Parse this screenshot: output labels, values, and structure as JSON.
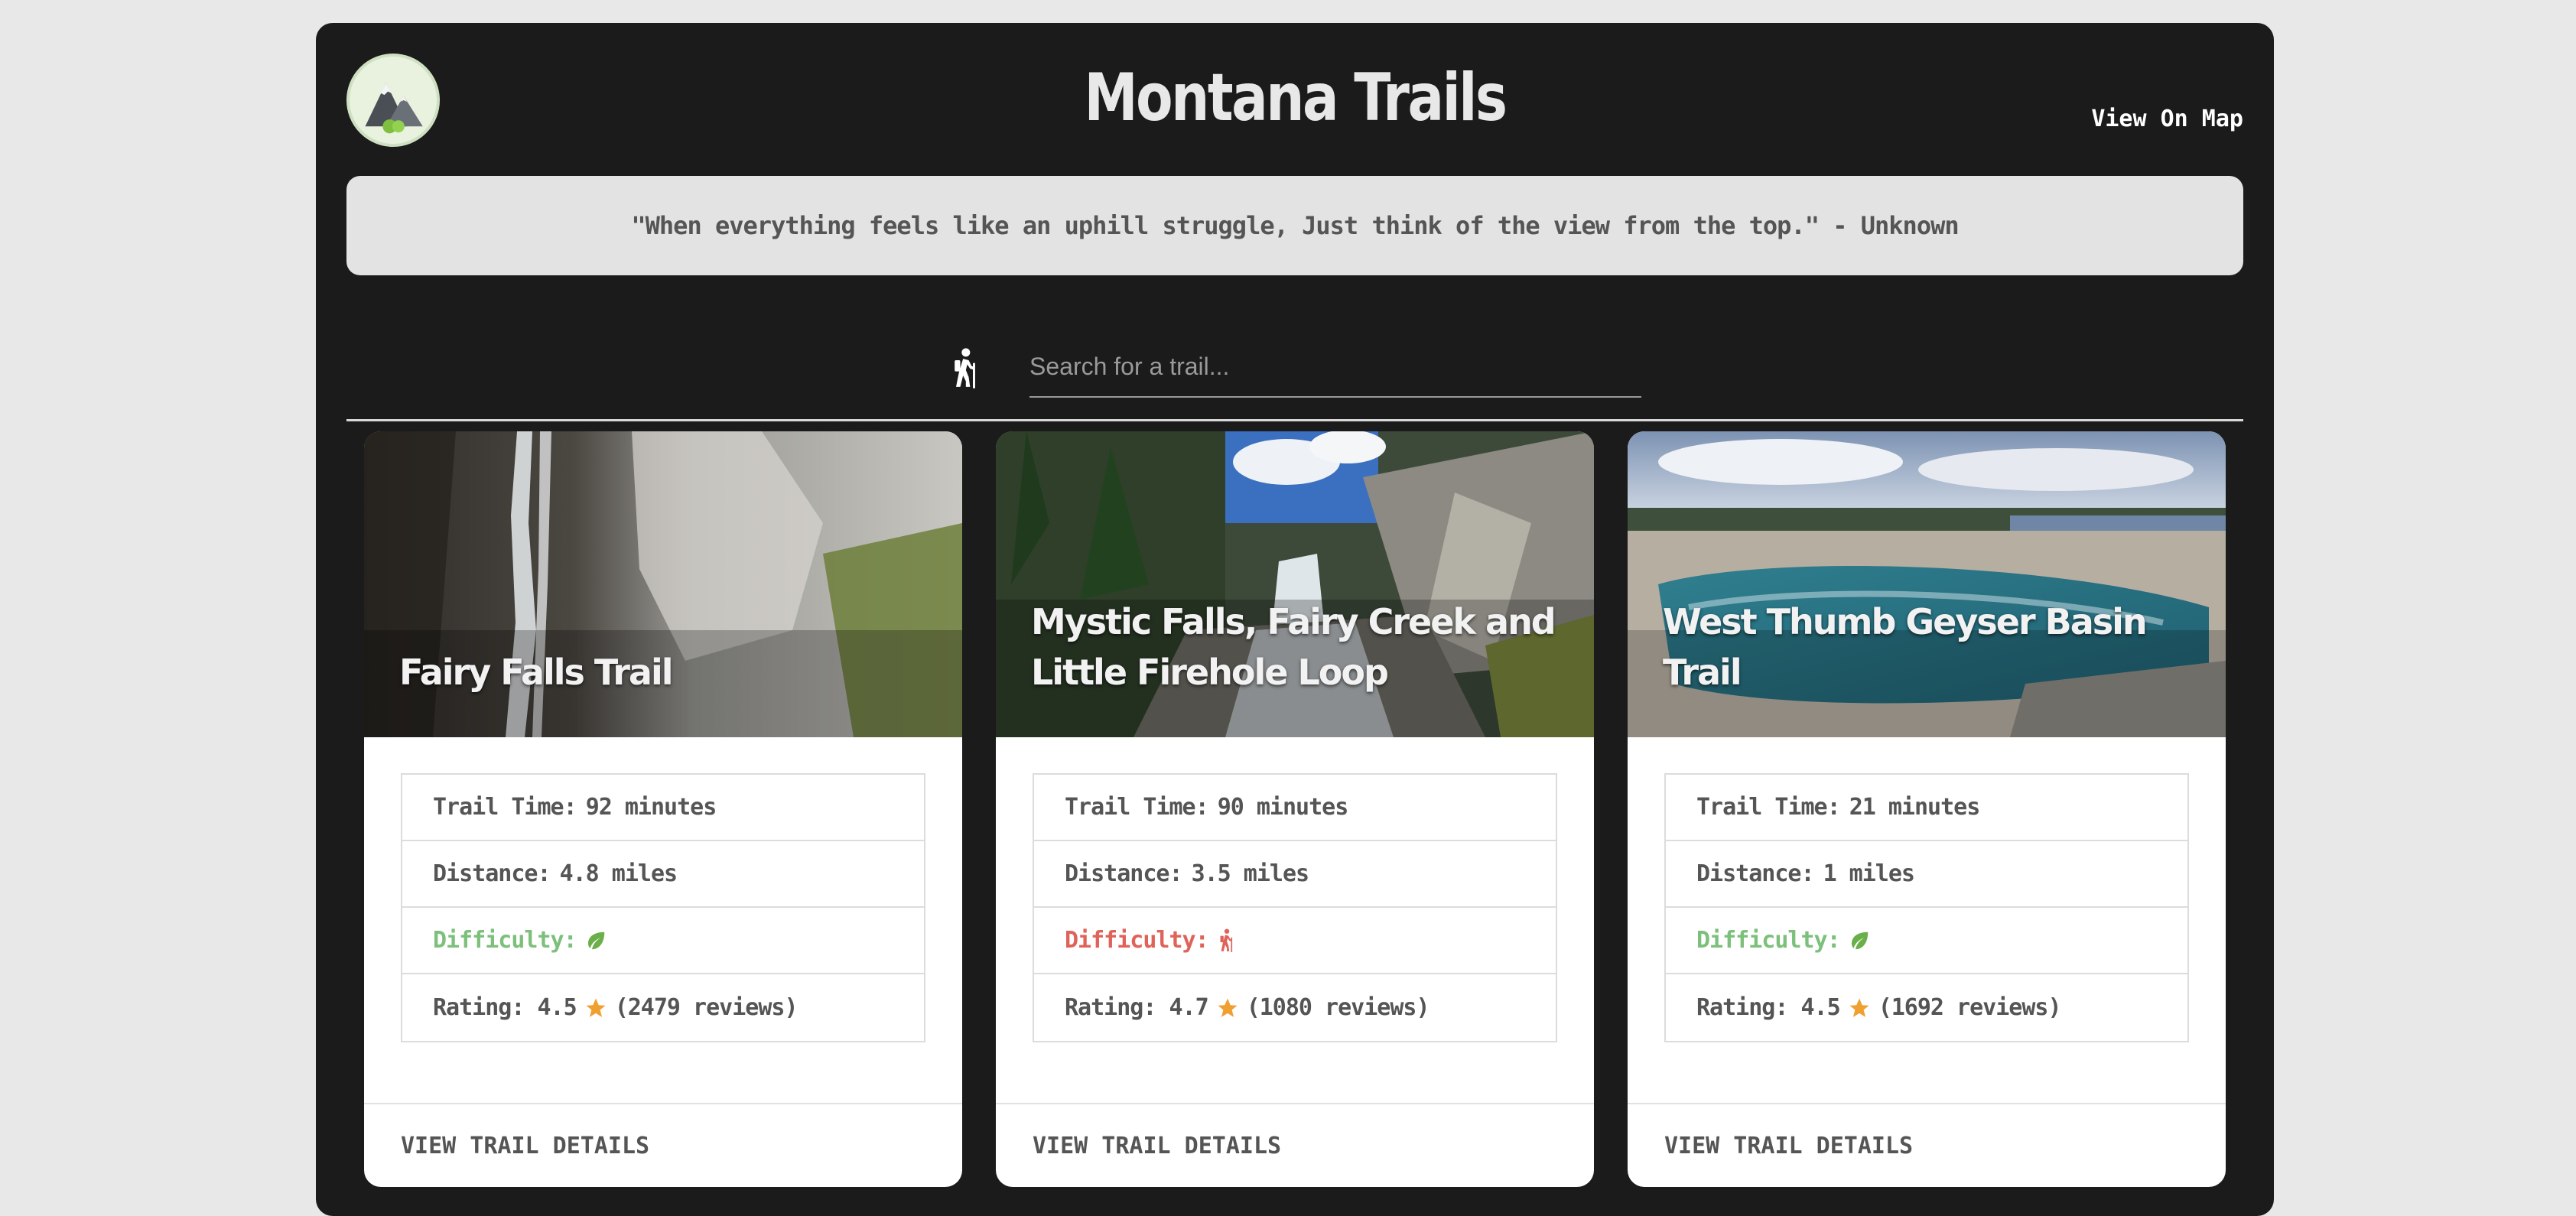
{
  "header": {
    "title": "Montana Trails",
    "map_link": "View On Map"
  },
  "quote": {
    "text": "\"When everything feels like an uphill struggle, Just think of the view from the top.\" - Unknown"
  },
  "search": {
    "placeholder": "Search for a trail..."
  },
  "icons": {
    "logo": "mountain-logo-icon",
    "search": "hiker-icon",
    "easy": "leaf-icon",
    "hard": "hiker-icon",
    "rating": "star-icon"
  },
  "colors": {
    "background": "#1b1b1b",
    "easy": "#7cc07c",
    "hard": "#e0635a",
    "star": "#f0a030"
  },
  "labels": {
    "trail_time": "Trail Time:",
    "distance": "Distance:",
    "difficulty": "Difficulty:",
    "rating": "Rating:",
    "view_details": "VIEW TRAIL DETAILS"
  },
  "trails": [
    {
      "name": "Fairy Falls Trail",
      "time": "92 minutes",
      "distance": "4.8 miles",
      "difficulty": "easy",
      "rating": "4.5",
      "reviews": "(2479 reviews)"
    },
    {
      "name": "Mystic Falls, Fairy Creek and Little Firehole Loop",
      "time": "90 minutes",
      "distance": "3.5 miles",
      "difficulty": "hard",
      "rating": "4.7",
      "reviews": "(1080 reviews)"
    },
    {
      "name": "West Thumb Geyser Basin Trail",
      "time": "21 minutes",
      "distance": "1 miles",
      "difficulty": "easy",
      "rating": "4.5",
      "reviews": "(1692 reviews)"
    }
  ]
}
